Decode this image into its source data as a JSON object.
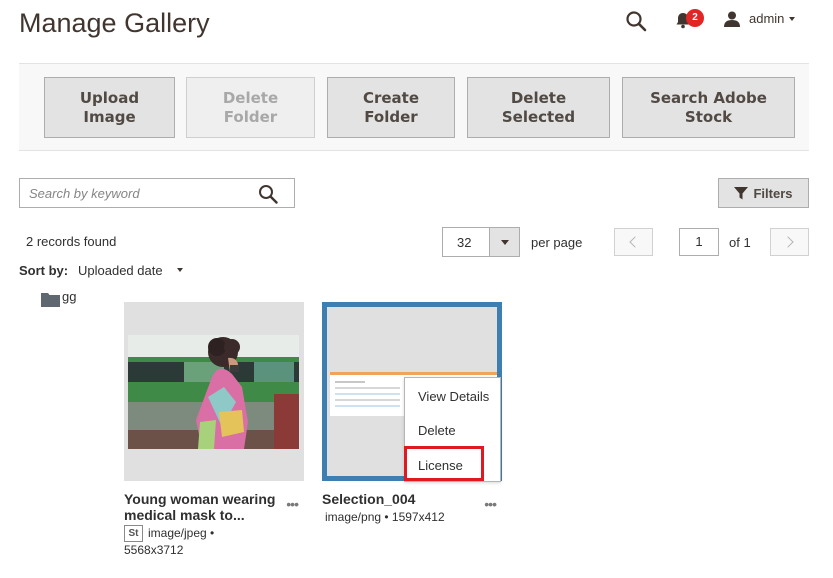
{
  "page": {
    "title": "Manage Gallery"
  },
  "header": {
    "notifications_count": "2",
    "user_name": "admin"
  },
  "toolbar": {
    "upload_image": "Upload Image",
    "delete_folder": "Delete Folder",
    "create_folder": "Create Folder",
    "delete_selected": "Delete Selected",
    "search_adobe_stock": "Search Adobe Stock"
  },
  "search": {
    "placeholder": "Search by keyword"
  },
  "filters": {
    "label": "Filters"
  },
  "listing": {
    "records_found": "2 records found",
    "per_page_value": "32",
    "per_page_label": "per page",
    "current_page": "1",
    "of_pages": "of 1",
    "sort_by_label": "Sort by:",
    "sort_by_value": "Uploaded date"
  },
  "folders": [
    {
      "name": "gg"
    }
  ],
  "assets": [
    {
      "title": "Young woman wearing medical mask to...",
      "badge": "St",
      "content_type": "image/jpeg •",
      "dimensions": "5568x3712",
      "more": "•••"
    },
    {
      "title": "Selection_004",
      "meta": "image/png • 1597x412",
      "more": "•••"
    }
  ],
  "context_menu": {
    "view_details": "View Details",
    "delete": "Delete",
    "license": "License"
  }
}
